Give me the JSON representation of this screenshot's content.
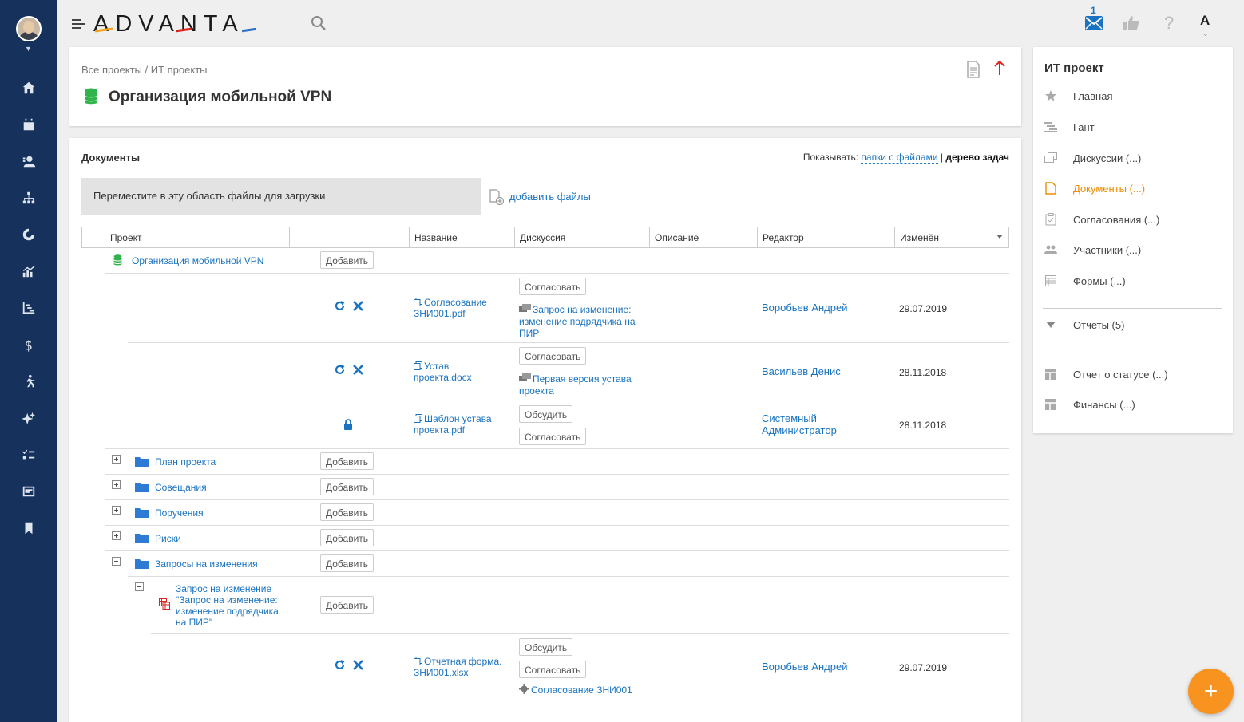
{
  "brand": {
    "logo_text": "ADVANTA"
  },
  "topbar": {
    "mail_count": "1",
    "lang_label": "A"
  },
  "header": {
    "breadcrumb_root": "Все проекты",
    "breadcrumb_sep": "/",
    "breadcrumb_current": "ИТ проекты",
    "title": "Организация мобильной VPN"
  },
  "docs": {
    "title": "Документы",
    "show_label": "Показывать:",
    "show_folders": "папки с файлами",
    "show_sep": "|",
    "show_tree": "дерево задач",
    "dropzone_text": "Переместите в эту область файлы для загрузки",
    "add_files": "добавить файлы",
    "columns": [
      "Проект",
      "",
      "Название",
      "Дискуссия",
      "Описание",
      "Редактор",
      "Изменён"
    ],
    "add_label": "Добавить",
    "approve_label": "Согласовать",
    "discuss_label": "Обсудить",
    "project_name": "Организация мобильной VPN",
    "files": [
      {
        "name_l1": "Согласование",
        "name_l2": "ЗНИ001.pdf",
        "discussion": "Запрос на изменение: изменение подрядчика на ПИР",
        "editor": "Воробьев Андрей",
        "date": "29.07.2019"
      },
      {
        "name_l1": "Устав",
        "name_l2": "проекта.docx",
        "discussion": "Первая версия устава проекта",
        "editor": "Васильев Денис",
        "date": "28.11.2018"
      },
      {
        "name_l1": "Шаблон устава",
        "name_l2": "проекта.pdf",
        "discussion": "",
        "editor": "Системный Администратор",
        "date": "28.11.2018"
      }
    ],
    "folders": [
      "План проекта",
      "Совещания",
      "Поручения",
      "Риски",
      "Запросы на изменения"
    ],
    "change_request": "Запрос на изменение \"Запрос на изменение: изменение подрядчика на ПИР\"",
    "cr_file": {
      "name_l1": "Отчетная форма.",
      "name_l2": "ЗНИ001.xlsx",
      "discussion": "Согласование ЗНИ001",
      "editor": "Воробьев Андрей",
      "date": "29.07.2019"
    }
  },
  "right_panel": {
    "title": "ИТ проект",
    "items": [
      {
        "label": "Главная",
        "icon": "star-icon"
      },
      {
        "label": "Гант",
        "icon": "gantt-icon"
      },
      {
        "label": "Дискуссии (...)",
        "icon": "discussion-icon"
      },
      {
        "label": "Документы (...)",
        "icon": "document-icon"
      },
      {
        "label": "Согласования (...)",
        "icon": "approval-icon"
      },
      {
        "label": "Участники (...)",
        "icon": "people-icon"
      },
      {
        "label": "Формы (...)",
        "icon": "form-icon"
      }
    ],
    "reports": "Отчеты (5)",
    "reports_items": [
      "Отчет о статусе (...)",
      "Финансы (...)"
    ]
  },
  "fab_label": "+",
  "colors": {
    "sidebar": "#16325c",
    "accent": "#f7931e",
    "link": "#1a73c0",
    "lock": "#1a73c0",
    "green": "#2fb34a"
  }
}
